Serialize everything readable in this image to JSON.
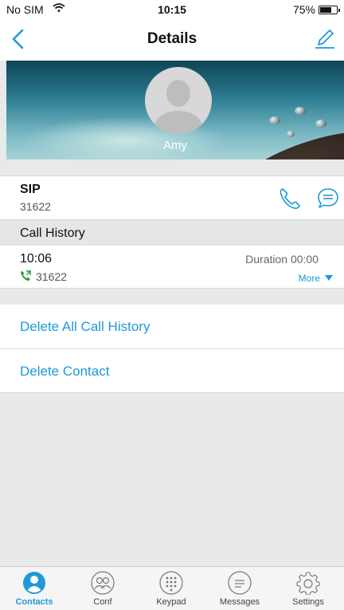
{
  "status_bar": {
    "carrier": "No SIM",
    "time": "10:15",
    "battery": "75%"
  },
  "nav": {
    "title": "Details"
  },
  "contact": {
    "name": "Amy"
  },
  "sip": {
    "label": "SIP",
    "number": "31622"
  },
  "call_history": {
    "header": "Call History",
    "entries": [
      {
        "time": "10:06",
        "number": "31622",
        "duration": "Duration 00:00",
        "more": "More"
      }
    ]
  },
  "actions": {
    "delete_history": "Delete All Call History",
    "delete_contact": "Delete Contact"
  },
  "tabs": [
    {
      "label": "Contacts",
      "icon": "contacts-icon",
      "active": true
    },
    {
      "label": "Conf",
      "icon": "conference-icon",
      "active": false
    },
    {
      "label": "Keypad",
      "icon": "keypad-icon",
      "active": false
    },
    {
      "label": "Messages",
      "icon": "messages-icon",
      "active": false
    },
    {
      "label": "Settings",
      "icon": "settings-icon",
      "active": false
    }
  ],
  "colors": {
    "accent": "#1e9ad6",
    "call_green": "#2a9a35"
  }
}
